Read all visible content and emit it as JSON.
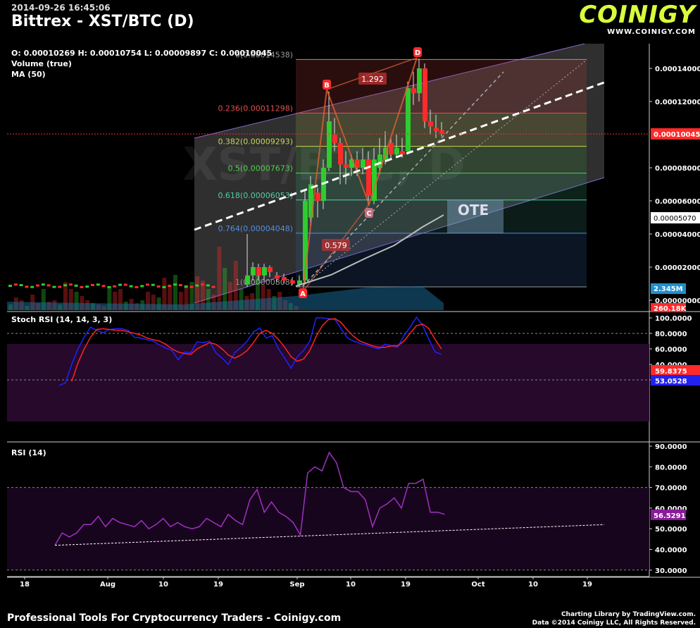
{
  "header": {
    "timestamp": "2014-09-26 16:45:06",
    "title": "Bittrex - XST/BTC (D)",
    "ohlc": "O: 0.00010269 H: 0.00010754 L: 0.00009897 C: 0.00010045",
    "volume_label": "Volume (true)",
    "ma_label": "MA (50)"
  },
  "logo": {
    "main": "COINIGY",
    "sub": "WWW.COINIGY.COM"
  },
  "footer": {
    "left": "Professional Tools For Cryptocurrency Traders - Coinigy.com",
    "right1": "Charting Library by TradingView.com.",
    "right2": "Data ©2014 Coinigy LLC, All Rights Reserved."
  },
  "colors": {
    "up": "#2ecc2e",
    "down": "#ff2a2a",
    "volume": "#1a6fa0",
    "stoch_k": "#2222ff",
    "stoch_d": "#ff2222",
    "rsi": "#a030c0",
    "accent": "#d8ff3a"
  },
  "chart_data": [
    {
      "type": "candlestick",
      "title": "Bittrex - XST/BTC (D)",
      "ylim": [
        0,
        0.000155
      ],
      "y_ticks": [
        "0.00014000",
        "0.00012000",
        "0.00008000",
        "0.00006000",
        "0.00004000",
        "0.00002000",
        "0.00000000"
      ],
      "x_ticks": [
        "18",
        "Aug",
        "10",
        "19",
        "Sep",
        "10",
        "19",
        "Oct",
        "10",
        "19"
      ],
      "last_price": "0.00010045",
      "ma_value": "0.00005070",
      "volume_values": [
        "2.345M",
        "260.18K"
      ],
      "fib_levels": [
        {
          "label": "0(0.00014538)",
          "value": 0.00014538,
          "color": "#999999"
        },
        {
          "label": "0.236(0.00011298)",
          "value": 0.00011298,
          "color": "#e05050"
        },
        {
          "label": "0.382(0.00009293)",
          "value": 9.293e-05,
          "color": "#c8d850"
        },
        {
          "label": "0.5(0.00007673)",
          "value": 7.673e-05,
          "color": "#50d050"
        },
        {
          "label": "0.618(0.00006053)",
          "value": 6.053e-05,
          "color": "#50d0a0"
        },
        {
          "label": "0.764(0.00004048)",
          "value": 4.048e-05,
          "color": "#5090e0"
        },
        {
          "label": "1(0.00000808)",
          "value": 8.08e-06,
          "color": "#999999"
        }
      ],
      "pattern_points": [
        {
          "label": "A",
          "value": 7.8e-06
        },
        {
          "label": "B",
          "value": 0.000126
        },
        {
          "label": "C",
          "value": 5.75e-05
        },
        {
          "label": "D",
          "value": 0.000146
        }
      ],
      "ratios": [
        "1.292",
        "0.579"
      ],
      "zone_label": "OTE",
      "watermark": "XST/BTC, D"
    },
    {
      "type": "line",
      "title": "Stoch RSI (14, 14, 3, 3)",
      "ylim": [
        10,
        102
      ],
      "y_ticks": [
        "100.0000",
        "80.0000",
        "60.0000",
        "40.0000",
        "20.0000"
      ],
      "bands": [
        80,
        20
      ],
      "series": [
        {
          "name": "K",
          "last": "53.0528",
          "values": [
            13,
            16,
            40,
            60,
            75,
            88,
            84,
            81,
            85,
            86,
            86,
            84,
            75,
            74,
            72,
            70,
            65,
            61,
            58,
            46,
            56,
            55,
            69,
            68,
            70,
            55,
            48,
            40,
            55,
            62,
            70,
            82,
            87,
            74,
            77,
            60,
            48,
            35,
            50,
            58,
            70,
            100,
            100,
            99,
            98,
            86,
            74,
            70,
            67,
            65,
            62,
            60,
            66,
            64,
            62,
            77,
            88,
            101,
            90,
            72,
            56,
            53
          ]
        },
        {
          "name": "D",
          "last": "59.8375",
          "values": [
            null,
            null,
            18,
            42,
            60,
            75,
            85,
            86,
            85,
            84,
            84,
            82,
            80,
            78,
            74,
            72,
            70,
            66,
            60,
            56,
            54,
            53,
            60,
            64,
            68,
            66,
            60,
            52,
            48,
            52,
            58,
            68,
            80,
            84,
            80,
            72,
            62,
            50,
            44,
            47,
            58,
            76,
            90,
            98,
            99,
            94,
            84,
            76,
            70,
            67,
            64,
            62,
            62,
            64,
            64,
            70,
            80,
            90,
            92,
            86,
            72,
            60
          ]
        }
      ]
    },
    {
      "type": "line",
      "title": "RSI (14)",
      "ylim": [
        28,
        92
      ],
      "y_ticks": [
        "90.0000",
        "80.0000",
        "70.0000",
        "60.0000",
        "50.0000",
        "40.0000",
        "30.0000"
      ],
      "bands": [
        70,
        30
      ],
      "series": [
        {
          "name": "RSI",
          "last": "56.5291",
          "values": [
            42,
            48,
            46,
            48,
            52,
            52,
            56,
            51,
            55,
            53,
            52,
            51,
            54,
            50,
            52,
            55,
            51,
            53,
            51,
            50,
            51,
            55,
            53,
            51,
            57,
            54,
            52,
            64,
            69,
            58,
            63,
            58,
            56,
            53,
            47,
            77,
            80,
            78,
            87,
            82,
            70,
            68,
            68,
            64,
            51,
            60,
            62,
            65,
            60,
            72,
            72,
            74,
            58,
            58,
            57
          ]
        },
        {
          "name": "trend",
          "values": [
            42,
            52
          ]
        }
      ]
    }
  ]
}
